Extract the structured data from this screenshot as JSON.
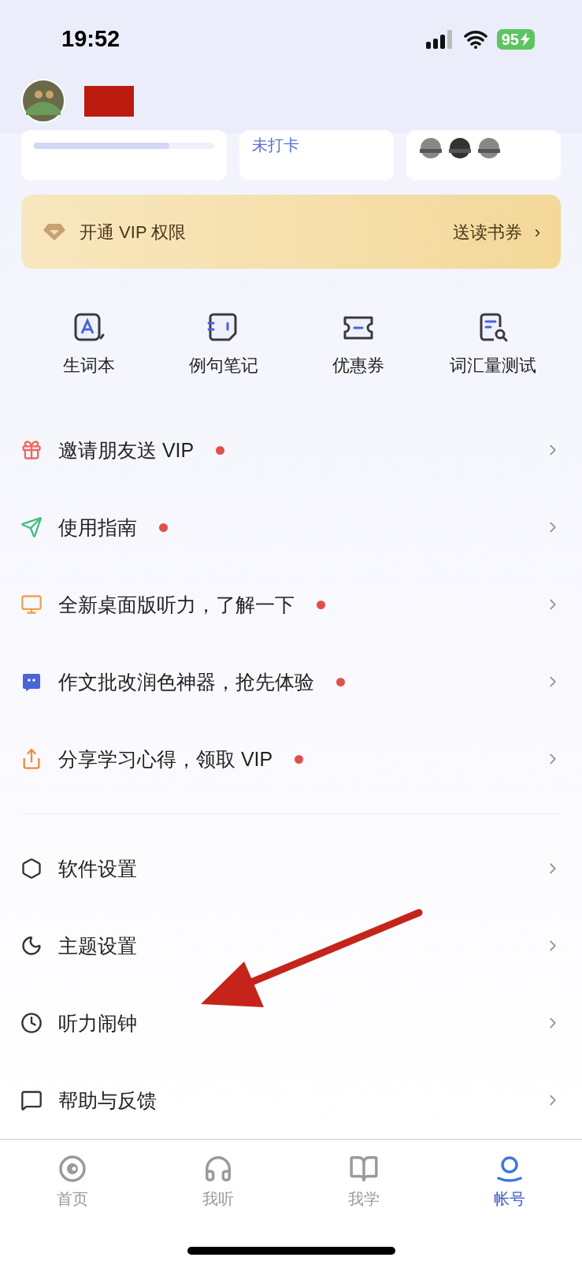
{
  "status_bar": {
    "time": "19:52",
    "battery": "95"
  },
  "stats_cards": [
    {
      "kind": "progress",
      "level": 0.75
    },
    {
      "kind": "text",
      "text": "未打卡"
    },
    {
      "kind": "badges"
    }
  ],
  "vip_banner": {
    "title": "开通 VIP 权限",
    "action": "送读书券",
    "chevron": "›"
  },
  "shortcuts": [
    {
      "kind": "wordbook",
      "label": "生词本"
    },
    {
      "kind": "notes",
      "label": "例句笔记"
    },
    {
      "kind": "coupon",
      "label": "优惠券"
    },
    {
      "kind": "test",
      "label": "词汇量测试"
    }
  ],
  "promo_items": [
    {
      "kind": "gift",
      "label": "邀请朋友送 VIP",
      "dot": true
    },
    {
      "kind": "send",
      "label": "使用指南",
      "dot": true
    },
    {
      "kind": "monitor",
      "label": "全新桌面版听力，了解一下",
      "dot": true
    },
    {
      "kind": "chat",
      "label": "作文批改润色神器，抢先体验",
      "dot": true
    },
    {
      "kind": "share",
      "label": "分享学习心得，领取 VIP",
      "dot": true
    }
  ],
  "settings_items": [
    {
      "kind": "hexagon",
      "label": "软件设置",
      "dot": false
    },
    {
      "kind": "moon",
      "label": "主题设置",
      "dot": false
    },
    {
      "kind": "clock",
      "label": "听力闹钟",
      "dot": false
    },
    {
      "kind": "message",
      "label": "帮助与反馈",
      "dot": false
    }
  ],
  "tab_bar": [
    {
      "kind": "home",
      "label": "首页",
      "selected": false
    },
    {
      "kind": "headphones",
      "label": "我听",
      "selected": false
    },
    {
      "kind": "book",
      "label": "我学",
      "selected": false
    },
    {
      "kind": "account",
      "label": "帐号",
      "selected": true
    }
  ]
}
